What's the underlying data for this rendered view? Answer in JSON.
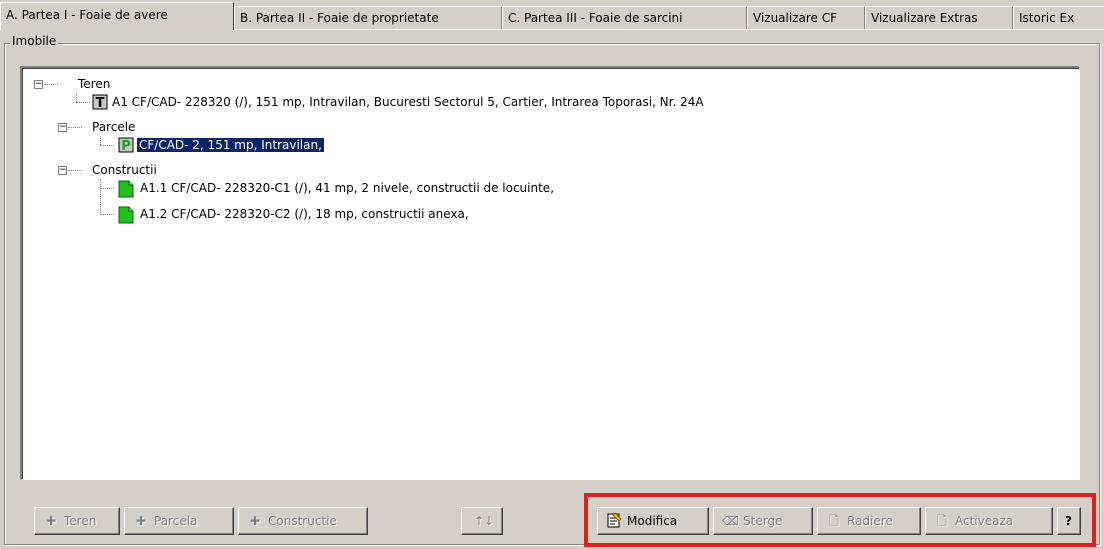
{
  "tabs": [
    {
      "label": "A. Partea I - Foaie de avere",
      "active": true
    },
    {
      "label": "B. Partea II - Foaie de proprietate",
      "active": false
    },
    {
      "label": "C. Partea III - Foaie de sarcini",
      "active": false
    },
    {
      "label": "Vizualizare CF",
      "active": false
    },
    {
      "label": "Vizualizare Extras",
      "active": false
    },
    {
      "label": "Istoric Ex",
      "active": false
    }
  ],
  "group": {
    "label": "Imobile"
  },
  "tree": {
    "teren_label": "Teren",
    "teren_item": "A1 CF/CAD- 228320 (/), 151 mp, Intravilan, Bucuresti Sectorul 5, Cartier, Intrarea Toporasi, Nr. 24A",
    "parcele_label": "Parcele",
    "parcela_item": "CF/CAD- 2, 151 mp, Intravilan,",
    "constructii_label": "Constructii",
    "constructie_1": "A1.1 CF/CAD- 228320-C1 (/), 41 mp, 2 nivele, constructii de locuinte,",
    "constructie_2": "A1.2 CF/CAD- 228320-C2 (/), 18 mp, constructii anexa,",
    "icon_teren_letter": "T",
    "icon_parcela_letter": "P",
    "colors": {
      "selection": "#0a246a",
      "icon_green": "#22c022"
    }
  },
  "buttons": {
    "teren": "Teren",
    "parcela": "Parcela",
    "constructie": "Constructie",
    "modifica": "Modifica",
    "sterge": "Sterge",
    "radiere": "Radiere",
    "activeaza": "Activeaza",
    "help": "?"
  },
  "highlight_color": "#e0201c"
}
